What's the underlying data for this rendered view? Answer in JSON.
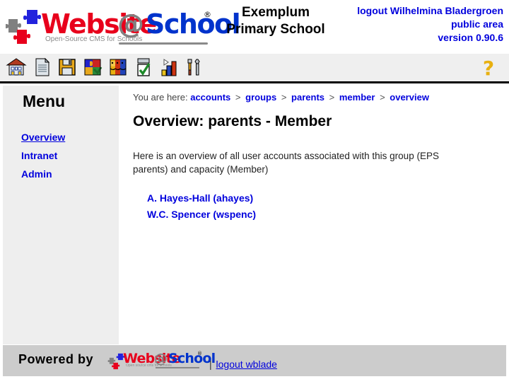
{
  "header": {
    "logo": {
      "word_1": "Website",
      "word_at": "@",
      "word_2": "School",
      "registered_mark": "®",
      "tagline": "Open-Source CMS for Schools"
    },
    "school_name_line1": "Exemplum",
    "school_name_line2": "Primary School",
    "logout_line": "logout Wilhelmina Bladergroen",
    "area_line": "public area",
    "version_line": "version 0.90.6"
  },
  "toolbar": {
    "icons": [
      {
        "name": "home-icon",
        "title": "Home"
      },
      {
        "name": "page-icon",
        "title": "Page"
      },
      {
        "name": "save-icon",
        "title": "Save"
      },
      {
        "name": "modules-icon",
        "title": "Modules"
      },
      {
        "name": "accounts-icon",
        "title": "Accounts"
      },
      {
        "name": "tasks-icon",
        "title": "Tasks"
      },
      {
        "name": "statistics-icon",
        "title": "Statistics"
      },
      {
        "name": "tools-icon",
        "title": "Tools"
      }
    ],
    "help": {
      "name": "help-icon",
      "glyph": "?",
      "title": "Help"
    }
  },
  "sidebar": {
    "title": "Menu",
    "items": [
      {
        "label": "Overview",
        "active": true
      },
      {
        "label": "Intranet",
        "active": false
      },
      {
        "label": "Admin",
        "active": false
      }
    ]
  },
  "main": {
    "breadcrumb": {
      "prefix": "You are here:",
      "separator": ">",
      "items": [
        "accounts",
        "groups",
        "parents",
        "member",
        "overview"
      ]
    },
    "page_title": "Overview: parents - Member",
    "intro": "Here is an overview of all user accounts associated with this group (EPS parents) and capacity (Member)",
    "accounts": [
      "A. Hayes-Hall (ahayes)",
      "W.C. Spencer (wspenc)"
    ]
  },
  "footer": {
    "powered_by": "Powered by",
    "logo": {
      "word_1": "Website",
      "word_at": "@",
      "word_2": "School",
      "registered_mark": "®",
      "tagline": "Open source cms for schools"
    },
    "separator": "|",
    "logout_label": "logout wblade"
  },
  "colors": {
    "link": "#0000dd",
    "toolbar_bg": "#efefef",
    "sidebar_bg": "#eeeeee",
    "footer_bg": "#cccccc",
    "logo_red": "#e8001c",
    "logo_blue": "#0033cc",
    "logo_gray": "#808080",
    "help_yellow": "#e8b010"
  }
}
